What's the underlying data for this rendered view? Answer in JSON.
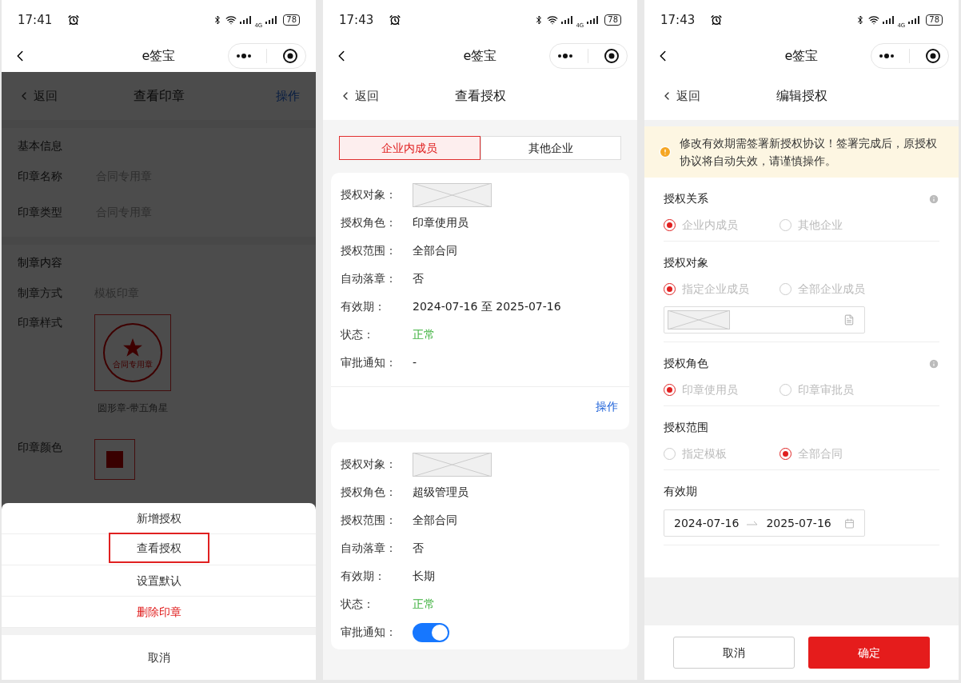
{
  "screens": [
    {
      "kind": "seal_view",
      "status_bar": {
        "time": "17:41",
        "network": "4G",
        "battery": "78"
      },
      "nav_title": "e签宝",
      "header": {
        "back": "返回",
        "title": "查看印章",
        "action": "操作"
      },
      "basic": {
        "title": "基本信息",
        "rows": [
          {
            "label": "印章名称",
            "value": "合同专用章"
          },
          {
            "label": "印章类型",
            "value": "合同专用章"
          }
        ]
      },
      "content": {
        "title": "制章内容",
        "method": {
          "label": "制章方式",
          "value": "模板印章"
        },
        "style": {
          "label": "印章样式",
          "seal_text": "合同专用章",
          "caption": "圆形章-带五角星"
        },
        "color": {
          "label": "印章颜色"
        }
      },
      "action_sheet": {
        "items": [
          {
            "label": "新增授权",
            "kind": "normal",
            "highlighted": false
          },
          {
            "label": "查看授权",
            "kind": "normal",
            "highlighted": true
          },
          {
            "label": "设置默认",
            "kind": "normal",
            "highlighted": false
          },
          {
            "label": "删除印章",
            "kind": "danger",
            "highlighted": false
          }
        ],
        "cancel": "取消"
      }
    },
    {
      "kind": "auth_list",
      "status_bar": {
        "time": "17:43",
        "network": "4G",
        "battery": "78"
      },
      "nav_title": "e签宝",
      "header": {
        "back": "返回",
        "title": "查看授权"
      },
      "tabs": [
        {
          "label": "企业内成员",
          "selected": true
        },
        {
          "label": "其他企业",
          "selected": false
        }
      ],
      "cards": [
        {
          "action": "操作",
          "rows": [
            {
              "label": "授权对象：",
              "kind": "image"
            },
            {
              "label": "授权角色：",
              "kind": "text",
              "value": "印章使用员"
            },
            {
              "label": "授权范围：",
              "kind": "text",
              "value": "全部合同"
            },
            {
              "label": "自动落章：",
              "kind": "text",
              "value": "否"
            },
            {
              "label": "有效期：",
              "kind": "text",
              "value": "2024-07-16 至 2025-07-16"
            },
            {
              "label": "状态：",
              "kind": "status",
              "value": "正常"
            },
            {
              "label": "审批通知：",
              "kind": "text",
              "value": "-"
            }
          ]
        },
        {
          "rows": [
            {
              "label": "授权对象：",
              "kind": "image"
            },
            {
              "label": "授权角色：",
              "kind": "text",
              "value": "超级管理员"
            },
            {
              "label": "授权范围：",
              "kind": "text",
              "value": "全部合同"
            },
            {
              "label": "自动落章：",
              "kind": "text",
              "value": "否"
            },
            {
              "label": "有效期：",
              "kind": "text",
              "value": "长期"
            },
            {
              "label": "状态：",
              "kind": "status",
              "value": "正常"
            },
            {
              "label": "审批通知：",
              "kind": "toggle",
              "on": true
            }
          ]
        }
      ]
    },
    {
      "kind": "auth_edit",
      "status_bar": {
        "time": "17:43",
        "network": "4G",
        "battery": "78"
      },
      "nav_title": "e签宝",
      "header": {
        "back": "返回",
        "title": "编辑授权"
      },
      "notice": "修改有效期需签署新授权协议！签署完成后，原授权协议将自动失效，请谨慎操作。",
      "sections": [
        {
          "title": "授权关系",
          "kind": "radio",
          "info": true,
          "picker": false,
          "options": [
            {
              "label": "企业内成员",
              "selected": true
            },
            {
              "label": "其他企业",
              "selected": false
            }
          ]
        },
        {
          "title": "授权对象",
          "kind": "radio",
          "info": false,
          "picker": true,
          "options": [
            {
              "label": "指定企业成员",
              "selected": true
            },
            {
              "label": "全部企业成员",
              "selected": false
            }
          ]
        },
        {
          "title": "授权角色",
          "kind": "radio",
          "info": true,
          "picker": false,
          "options": [
            {
              "label": "印章使用员",
              "selected": true
            },
            {
              "label": "印章审批员",
              "selected": false
            }
          ]
        },
        {
          "title": "授权范围",
          "kind": "radio",
          "info": false,
          "picker": false,
          "options": [
            {
              "label": "指定模板",
              "selected": false
            },
            {
              "label": "全部合同",
              "selected": true
            }
          ]
        },
        {
          "title": "有效期",
          "kind": "date_range",
          "info": false,
          "start": "2024-07-16",
          "end": "2025-07-16"
        }
      ],
      "buttons": {
        "cancel": "取消",
        "confirm": "确定"
      }
    }
  ]
}
